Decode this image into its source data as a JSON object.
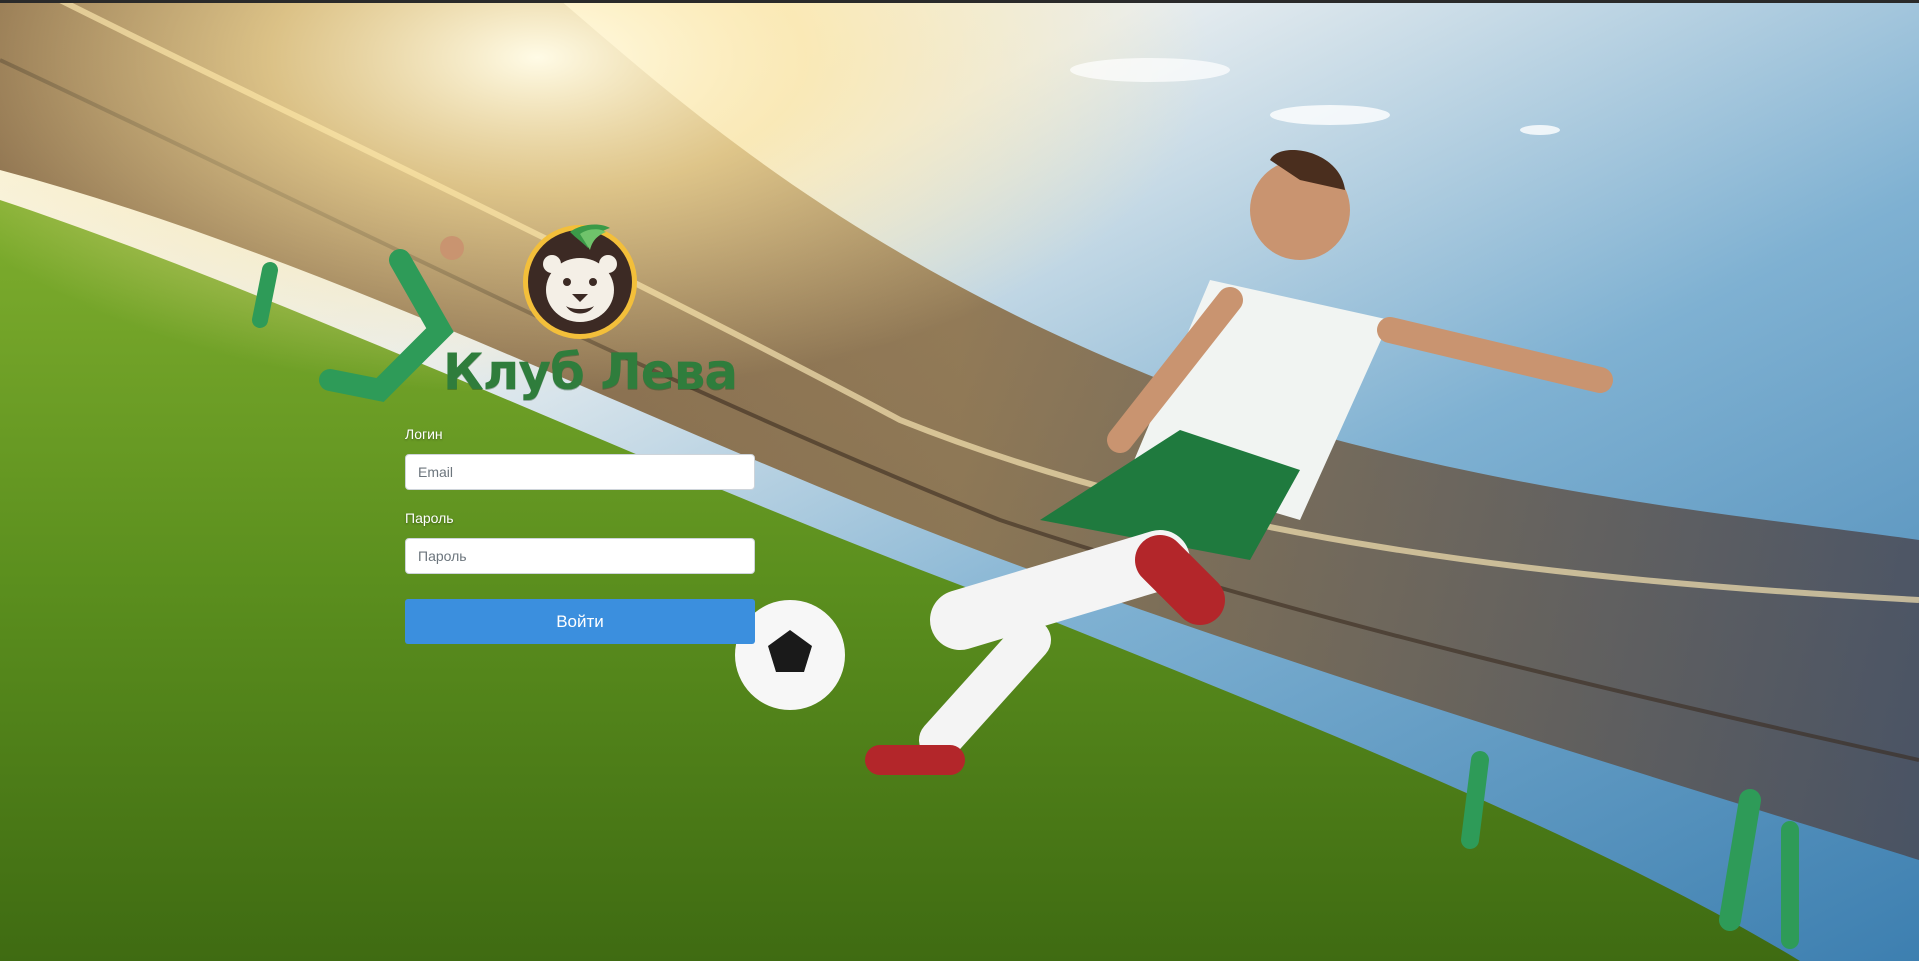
{
  "brand": {
    "logo_icon": "lion-head-logo-icon",
    "name": "Клуб Лева",
    "color": "#2f7d3c"
  },
  "form": {
    "login_label": "Логин",
    "login_placeholder": "Email",
    "login_value": "",
    "password_label": "Пароль",
    "password_placeholder": "Пароль",
    "password_value": "",
    "submit_label": "Войти",
    "button_color": "#3b8fde"
  },
  "background": {
    "image": "stadium-football-player-background"
  }
}
